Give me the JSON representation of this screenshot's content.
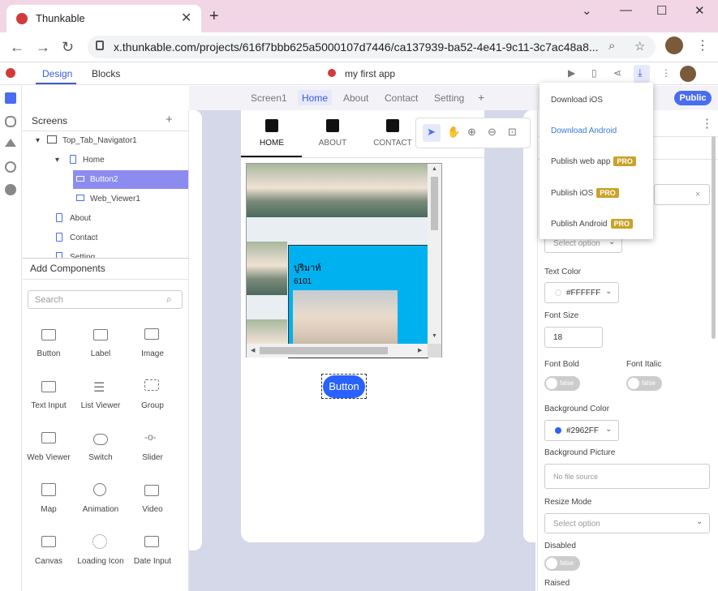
{
  "browser": {
    "tab_title": "Thunkable",
    "new_tab": "+",
    "url": "x.thunkable.com/projects/616f7bbb625a5000107d7446/ca137939-ba52-4e41-9c11-3c7ac48a8...",
    "win_min": "⌄",
    "win_restore": "—",
    "win_max": "☐",
    "win_close": "✕"
  },
  "header": {
    "tabs": [
      "Design",
      "Blocks"
    ],
    "app_name": "my first app",
    "public_label": "Public"
  },
  "screens_bar": [
    "Screen1",
    "Home",
    "About",
    "Contact",
    "Setting",
    "+"
  ],
  "screens_panel": {
    "title": "Screens",
    "add": "+",
    "tree": [
      "Top_Tab_Navigator1",
      "Home",
      "Button2",
      "Web_Viewer1",
      "About",
      "Contact",
      "Setting"
    ]
  },
  "add_components": {
    "title": "Add Components",
    "search_placeholder": "Search",
    "items": [
      "Button",
      "Label",
      "Image",
      "Text Input",
      "List Viewer",
      "Group",
      "Web Viewer",
      "Switch",
      "Slider",
      "Map",
      "Animation",
      "Video",
      "Canvas",
      "Loading Icon",
      "Date Input"
    ]
  },
  "phone": {
    "nav_tabs": [
      "HOME",
      "ABOUT",
      "CONTACT"
    ],
    "cyan_title": "ปูริมาท์",
    "cyan_code": "6101",
    "button_label": "Button"
  },
  "download_menu": {
    "items": [
      "Download iOS",
      "Download Android",
      "Publish web app",
      "Publish iOS",
      "Publish Android"
    ],
    "pro_badge": "PRO"
  },
  "properties": {
    "select_option": "Select option",
    "text_color_label": "Text Color",
    "text_color_value": "#FFFFFF",
    "font_size_label": "Font Size",
    "font_size_value": "18",
    "font_bold_label": "Font Bold",
    "font_italic_label": "Font Italic",
    "false": "false",
    "bg_color_label": "Background Color",
    "bg_color_value": "#2962FF",
    "bg_picture_label": "Background Picture",
    "no_file": "No file source",
    "resize_mode_label": "Resize Mode",
    "disabled_label": "Disabled",
    "raised_label": "Raised"
  },
  "colors": {
    "accent": "#3a5bd9",
    "button_bg": "#2962FF",
    "selection": "#8c8cf0",
    "cyan_panel": "#00b1ef",
    "pro_badge": "#c9a227"
  }
}
